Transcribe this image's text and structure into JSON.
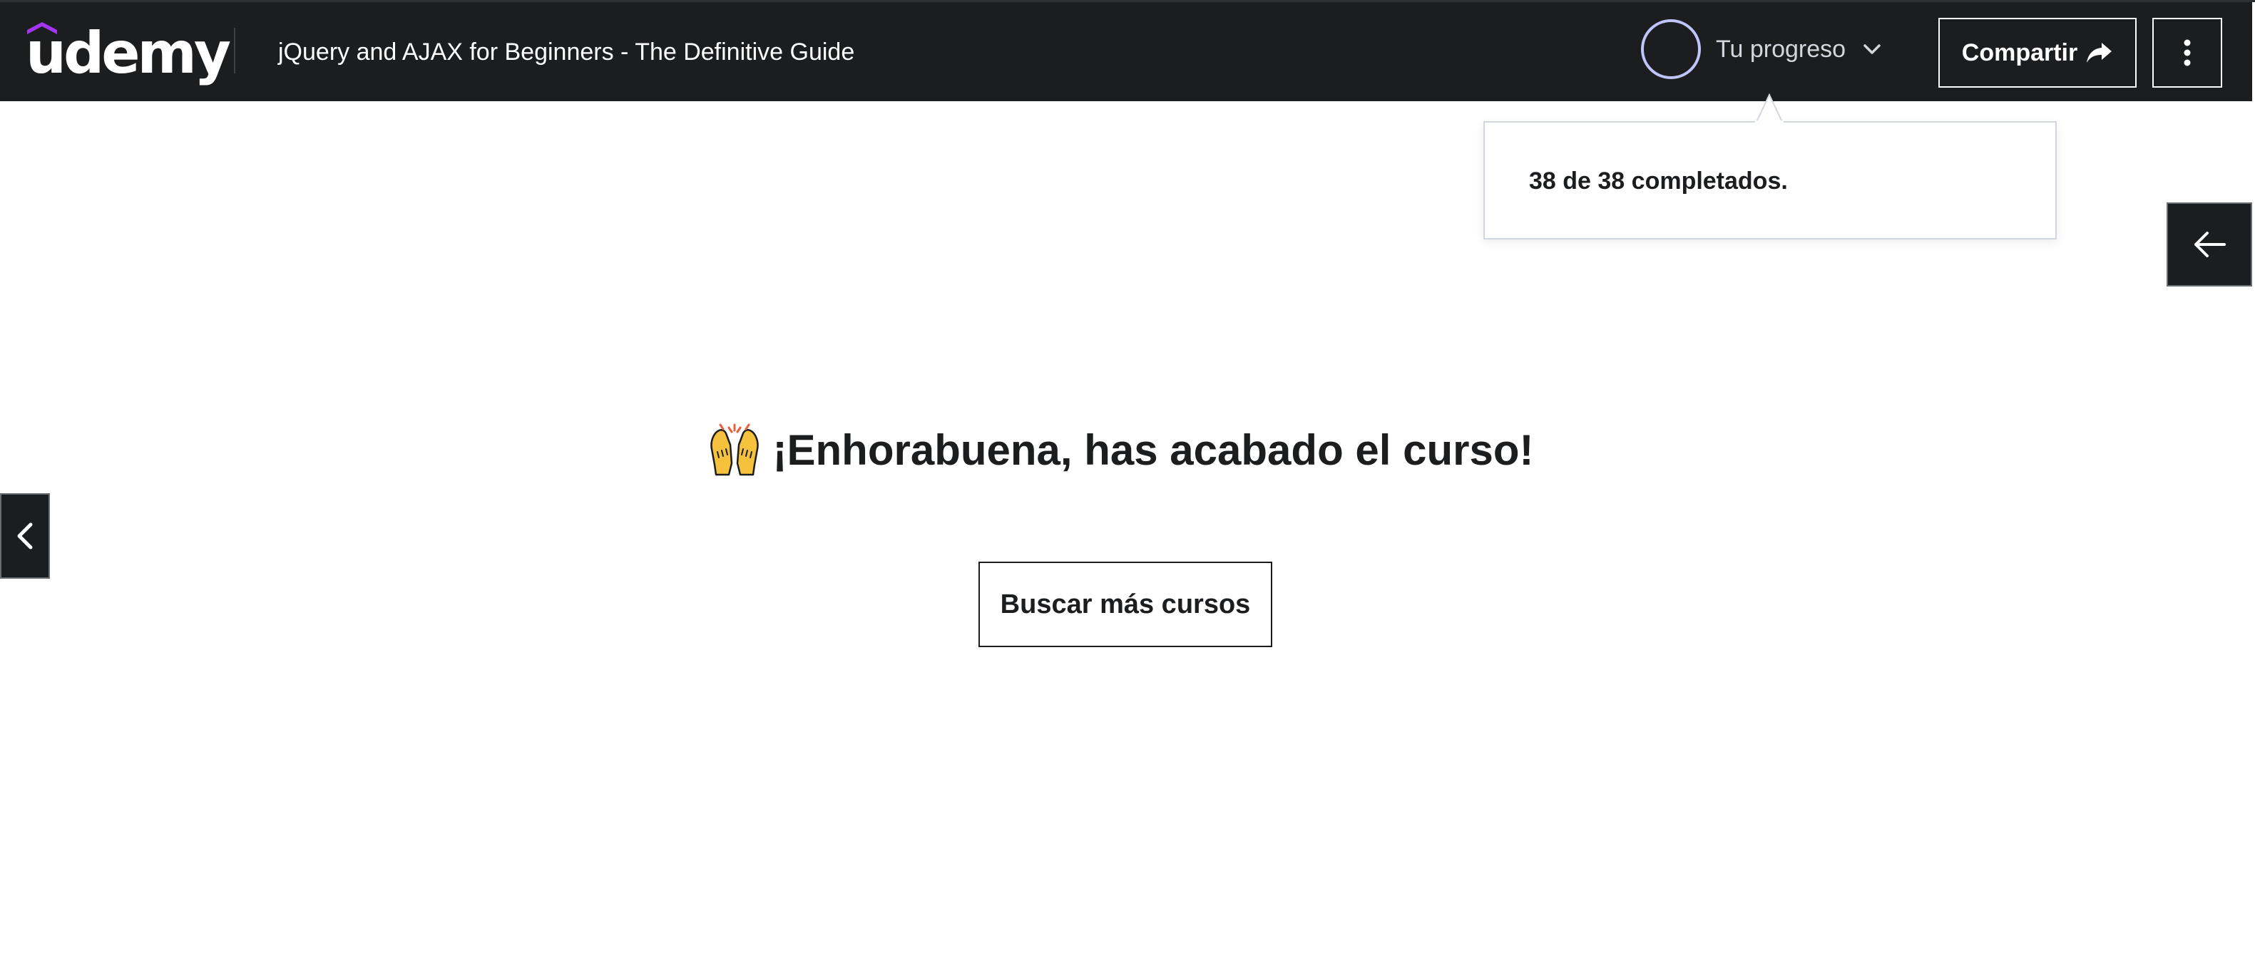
{
  "header": {
    "brand": "udemy",
    "course_title": "jQuery and AJAX for Beginners - The Definitive Guide",
    "progress_label": "Tu progreso",
    "share_label": "Compartir"
  },
  "progress_popover": {
    "completed_text": "38 de 38 completados.",
    "completed": 38,
    "total": 38
  },
  "main": {
    "congrats_emoji": "🙌",
    "congrats_text": "¡Enhorabuena, has acabado el curso!",
    "browse_button_label": "Buscar más cursos"
  },
  "icons": {
    "brand_hat": "udemy-hat-icon",
    "progress": "progress-ring-icon",
    "dropdown": "chevron-down-icon",
    "share": "share-arrow-icon",
    "more": "kebab-menu-icon",
    "sidebar_toggle": "arrow-left-icon",
    "previous": "chevron-left-icon",
    "celebration": "raising-hands-icon"
  },
  "colors": {
    "header_bg": "#1c1d1f",
    "brand_purple": "#a435f0",
    "progress_ring": "#c0c4fc",
    "text_dark": "#1c1d1f",
    "white": "#ffffff"
  }
}
